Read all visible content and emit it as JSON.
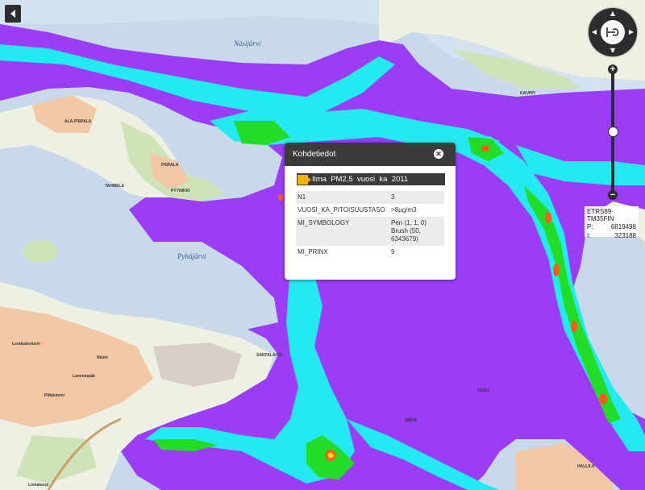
{
  "map": {
    "place_labels": [
      "Näsijärvi",
      "Pyhäjärvi",
      "ALA-PISPALA",
      "PISPALA",
      "TAHMELA",
      "PYYNIKKI",
      "SANTALAHTI",
      "KAUPPI",
      "VEISU",
      "NIRVA",
      "HALLILA",
      "Lentävänniemi",
      "Lamminpää",
      "Niemi",
      "Linnakorpi",
      "Pitkäniemi"
    ],
    "colors": {
      "water": "#c8daea",
      "land": "#eef0e4",
      "forest": "#cfe3b9",
      "urban": "#f1c7a5",
      "overlay_purple": "#9b3df5",
      "overlay_cyan": "#24e9f0",
      "overlay_green": "#22dc28",
      "overlay_orange": "#ff5a1e",
      "overlay_yellow": "#f7e000"
    }
  },
  "controls": {
    "back_icon": "chevron-left-icon",
    "pan_icons": [
      "arrow-up-icon",
      "arrow-down-icon",
      "arrow-left-icon",
      "arrow-right-icon"
    ],
    "center_icon": "reset-extent-icon",
    "zoom_in_label": "+",
    "zoom_out_label": "−",
    "zoom_level_fraction": 0.45
  },
  "coordinates": {
    "system": "ETRS89-TM35FIN",
    "p_label": "P:",
    "p_value": "6819498",
    "i_label": "I:",
    "i_value": "323188"
  },
  "popup": {
    "title": "Kohdetiedot",
    "close_icon": "close-icon",
    "layer_name": "Ilma  PM2,5  vuosi  ka  2011",
    "rows": [
      {
        "key": "N1",
        "value": "3"
      },
      {
        "key": "VUOSI_KA_PITOISUUSTASO",
        "value": ">8µg/m3"
      },
      {
        "key": "MI_SYMBOLOGY",
        "value": "Pen (1, 1, 0) Brush (50, 6343679)"
      },
      {
        "key": "MI_PRINX",
        "value": "9"
      }
    ]
  }
}
